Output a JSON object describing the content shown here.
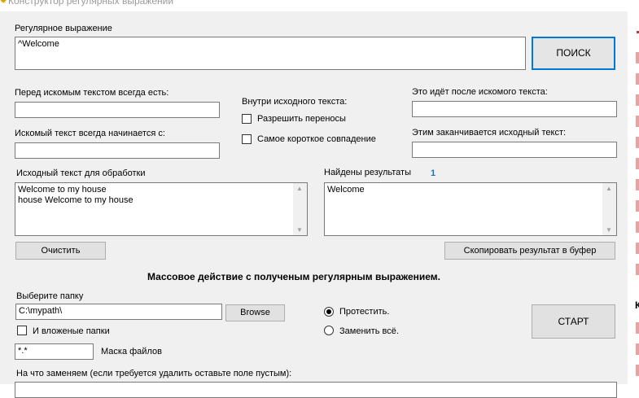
{
  "window": {
    "title": "Конструктор регулярных выражений"
  },
  "regex": {
    "label": "Регулярное выражение",
    "value": "^Welcome",
    "search_button": "ПОИСК"
  },
  "before": {
    "label": "Перед искомым текстом всегда есть:",
    "value": ""
  },
  "starts": {
    "label": "Искомый текст всегда начинается с:",
    "value": ""
  },
  "inside": {
    "label": "Внутри исходного текста:",
    "allow_wrap": "Разрешить переносы",
    "shortest": "Самое короткое совпадение"
  },
  "after": {
    "label": "Это идёт после искомого текста:",
    "value": ""
  },
  "ends": {
    "label": "Этим заканчивается исходный текст:",
    "value": ""
  },
  "source": {
    "label": "Исходный текст для обработки",
    "text": "Welcome to my house\nhouse Welcome to my house",
    "clear_button": "Очистить"
  },
  "results": {
    "label": "Найдены результаты",
    "count": "1",
    "text": "Welcome",
    "copy_button": "Скопировать результат в буфер"
  },
  "batch": {
    "heading": "Массовое действие с полученым регулярным выражением.",
    "folder_label": "Выберите папку",
    "folder_value": "C:\\mypath\\",
    "browse_button": "Browse",
    "subfolders": "И вложеные папки",
    "mask_value": "*.*",
    "mask_label": "Маска файлов",
    "option_test": "Протестить.",
    "option_replace": "Заменить всё.",
    "start_button": "СТАРТ",
    "replace_label": "На что заменяем (если требуется удалить оставьте поле пустым):"
  },
  "right_panel": {
    "label_k": "К"
  },
  "colors": {
    "form_bg": "#f0f0f0",
    "accent": "#0078d7",
    "count": "#1f6fbf"
  }
}
